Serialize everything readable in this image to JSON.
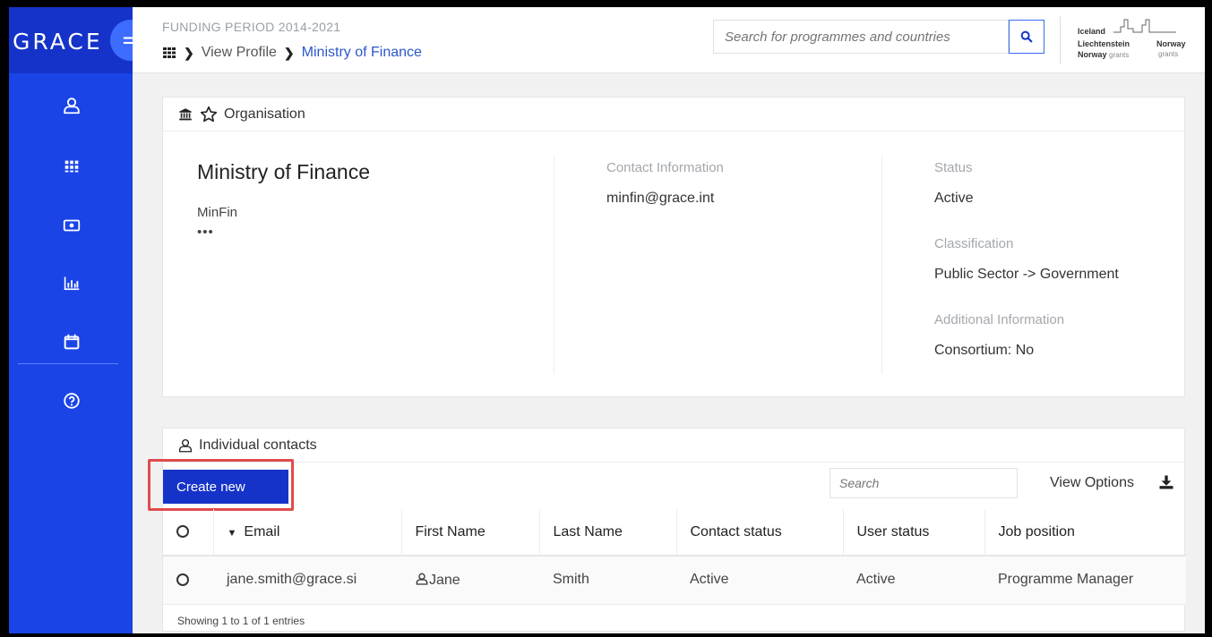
{
  "brand": {
    "name": "GRACE"
  },
  "header": {
    "period": "FUNDING PERIOD 2014-2021",
    "breadcrumb": [
      "View Profile",
      "Ministry of Finance"
    ],
    "search_placeholder": "Search for programmes and countries",
    "logo": {
      "line1": "Iceland",
      "line2": "Liechtenstein",
      "line3": "Norway",
      "line3b": "grants",
      "line4": "Norway",
      "line5": "grants"
    }
  },
  "sidebar": {
    "icons": [
      "user-icon",
      "grid-icon",
      "money-icon",
      "chart-icon",
      "calendar-icon",
      "help-icon"
    ]
  },
  "organisation": {
    "section_title": "Organisation",
    "name": "Ministry of Finance",
    "short_name": "MinFin",
    "dots": "•••",
    "contact_label": "Contact Information",
    "contact_email": "minfin@grace.int",
    "status_label": "Status",
    "status_value": "Active",
    "classification_label": "Classification",
    "classification_value": "Public Sector -> Government",
    "additional_label": "Additional Information",
    "additional_value": "Consortium: No"
  },
  "contacts": {
    "section_title": "Individual contacts",
    "create_label": "Create new",
    "search_placeholder": "Search",
    "view_options": "View Options",
    "columns": [
      "Email",
      "First Name",
      "Last Name",
      "Contact status",
      "User status",
      "Job position"
    ],
    "rows": [
      {
        "email": "jane.smith@grace.si",
        "first": "Jane",
        "last": "Smith",
        "contact_status": "Active",
        "user_status": "Active",
        "job": "Programme Manager"
      }
    ],
    "footer": "Showing 1 to 1 of 1 entries"
  }
}
